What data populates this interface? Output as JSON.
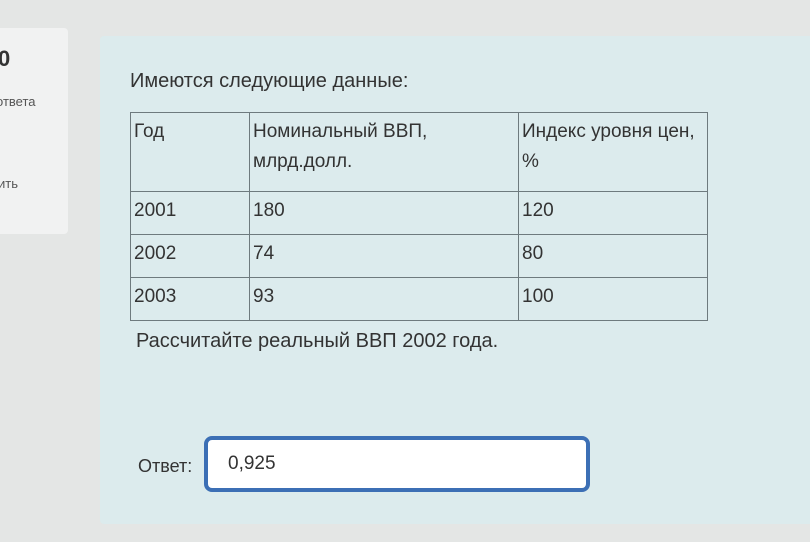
{
  "sidebar": {
    "question_number": "0",
    "status": "ответа",
    "flag_link": "ить"
  },
  "question": {
    "lead_text": "Имеются следующие данные:",
    "table": {
      "headers": [
        "Год",
        "Номинальный ВВП, млрд.долл.",
        "Индекс уровня цен, %"
      ],
      "rows": [
        [
          "2001",
          "180",
          "120"
        ],
        [
          "2002",
          "74",
          "80"
        ],
        [
          "2003",
          "93",
          "100"
        ]
      ]
    },
    "instruction": "Рассчитайте реальный ВВП 2002 года."
  },
  "answer": {
    "label": "Ответ:",
    "value": "0,925"
  }
}
